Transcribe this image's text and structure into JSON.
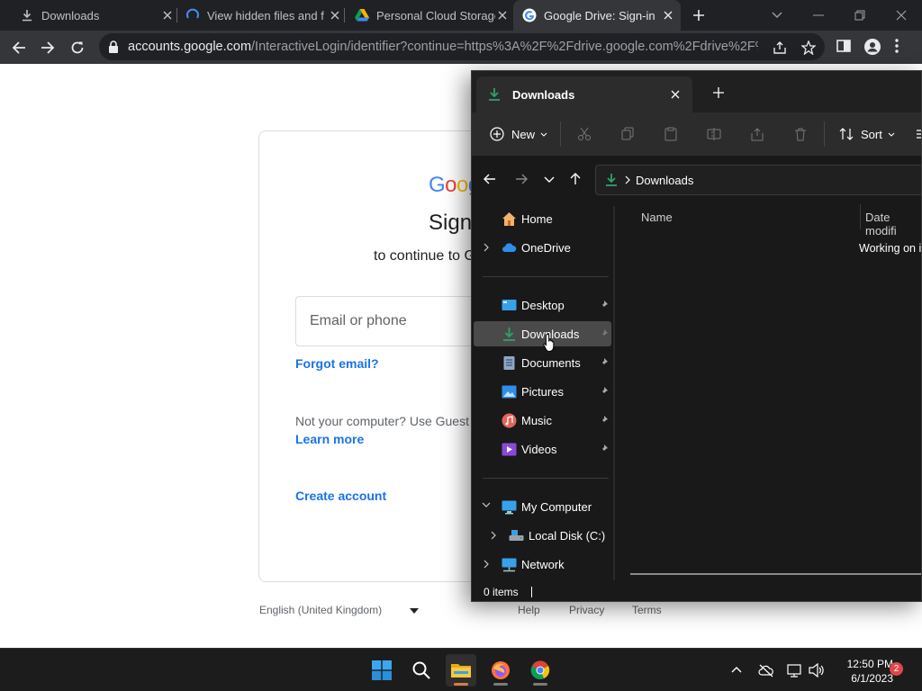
{
  "browser": {
    "tabs": [
      {
        "title": "Downloads",
        "icon": "download-icon"
      },
      {
        "title": "View hidden files and f",
        "icon": "loading-spinner-icon"
      },
      {
        "title": "Personal Cloud Storage",
        "icon": "google-drive-icon"
      },
      {
        "title": "Google Drive: Sign-in",
        "icon": "google-icon"
      }
    ],
    "active_tab": 3,
    "url_host": "accounts.google.com",
    "url_path": "/InteractiveLogin/identifier?continue=https%3A%2F%2Fdrive.google.com%2Fdrive%2F%3F..."
  },
  "signin": {
    "logo": "Goog",
    "title": "Sign",
    "subtitle": "to continue to G",
    "email_placeholder": "Email or phone",
    "forgot": "Forgot email?",
    "guest_text": "Not your computer? Use Guest",
    "learn_more": "Learn more",
    "create_account": "Create account"
  },
  "footer": {
    "language": "English (United Kingdom)",
    "help": "Help",
    "privacy": "Privacy",
    "terms": "Terms"
  },
  "explorer": {
    "tab_title": "Downloads",
    "new_label": "New",
    "sort_label": "Sort",
    "breadcrumb": "Downloads",
    "sidebar": {
      "home": "Home",
      "onedrive": "OneDrive",
      "desktop": "Desktop",
      "downloads": "Downloads",
      "documents": "Documents",
      "pictures": "Pictures",
      "music": "Music",
      "videos": "Videos",
      "my_computer": "My Computer",
      "local_disk": "Local Disk (C:)",
      "network": "Network"
    },
    "columns": {
      "name": "Name",
      "date": "Date modifi"
    },
    "status_text": "Working on it",
    "item_count": "0 items"
  },
  "taskbar": {
    "time": "12:50 PM",
    "date": "6/1/2023",
    "notifications": "2"
  },
  "colors": {
    "chrome_dark": "#202124",
    "chrome_toolbar": "#35363a",
    "google_blue": "#1a73e8",
    "explorer_bg": "#191919",
    "download_green": "#2ea36b"
  }
}
